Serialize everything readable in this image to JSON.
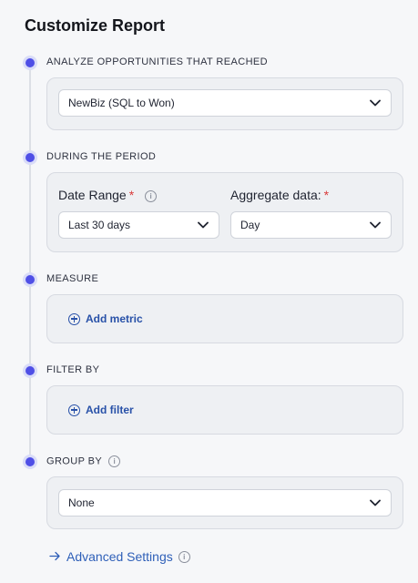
{
  "title": "Customize Report",
  "sections": {
    "analyze": {
      "label": "ANALYZE OPPORTUNITIES THAT REACHED",
      "select_value": "NewBiz (SQL to Won)"
    },
    "period": {
      "label": "DURING THE PERIOD",
      "date_range_label": "Date Range",
      "date_range_value": "Last 30 days",
      "aggregate_label": "Aggregate data:",
      "aggregate_value": "Day",
      "required_mark": "*",
      "info_glyph": "i"
    },
    "measure": {
      "label": "MEASURE",
      "add_label": "Add metric"
    },
    "filter": {
      "label": "FILTER BY",
      "add_label": "Add filter"
    },
    "group": {
      "label": "GROUP BY",
      "info_glyph": "i",
      "select_value": "None"
    }
  },
  "advanced": {
    "label": "Advanced Settings",
    "info_glyph": "i"
  },
  "colors": {
    "accent_dot": "#4f4fe6",
    "link": "#2e5fb8",
    "required": "#d93a3a"
  }
}
